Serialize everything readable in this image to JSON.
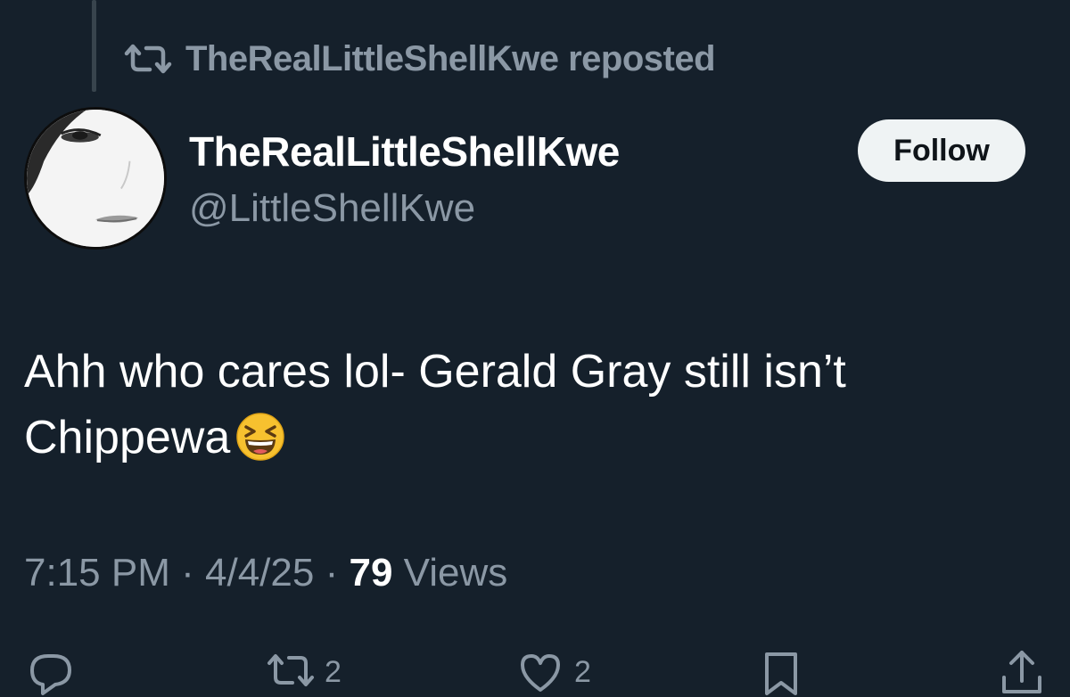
{
  "repost": {
    "icon": "repost-icon",
    "text": "TheRealLittleShellKwe reposted"
  },
  "author": {
    "display_name": "TheRealLittleShellKwe",
    "handle": "@LittleShellKwe",
    "avatar": "avatar"
  },
  "follow_button": {
    "label": "Follow"
  },
  "post": {
    "text": "Ahh who cares lol- Gerald Gray still isn’t Chippewa",
    "emoji": "grinning-squinting-face-emoji"
  },
  "meta": {
    "time": "7:15 PM",
    "separator": "·",
    "date": "4/4/25",
    "views_count": "79",
    "views_label": "Views"
  },
  "actions": {
    "reply": {
      "icon": "reply-icon",
      "count": ""
    },
    "repost": {
      "icon": "repost-icon",
      "count": "2"
    },
    "like": {
      "icon": "heart-icon",
      "count": "2"
    },
    "bookmark": {
      "icon": "bookmark-icon",
      "count": ""
    },
    "share": {
      "icon": "share-icon",
      "count": ""
    }
  },
  "colors": {
    "background": "#15202b",
    "primary_text": "#ffffff",
    "secondary_text": "#8b98a5",
    "follow_button_bg": "#eff3f4",
    "follow_button_text": "#0f1419"
  }
}
